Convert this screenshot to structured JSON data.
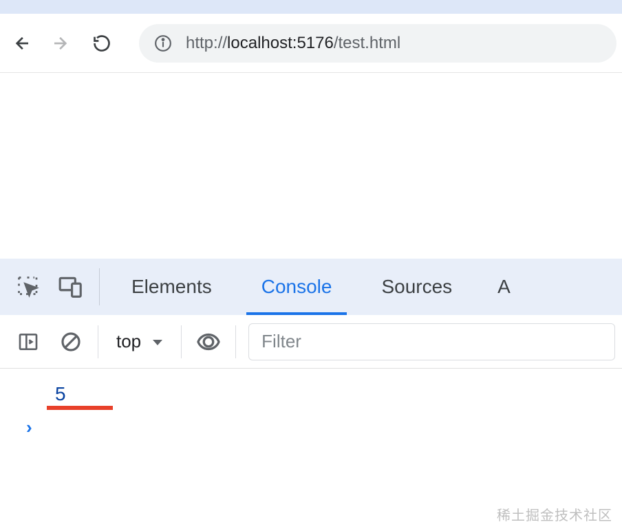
{
  "browser": {
    "url": "http://localhost:5176/test.html",
    "url_scheme_host": "localhost:5176",
    "url_prefix": "http://",
    "url_path": "/test.html"
  },
  "devtools": {
    "tabs": [
      {
        "label": "Elements"
      },
      {
        "label": "Console"
      },
      {
        "label": "Sources"
      }
    ],
    "active_tab_index": 1,
    "context_selector": "top",
    "filter_placeholder": "Filter"
  },
  "console": {
    "output_value": "5",
    "prompt_symbol": "›"
  },
  "watermark": "稀土掘金技术社区"
}
